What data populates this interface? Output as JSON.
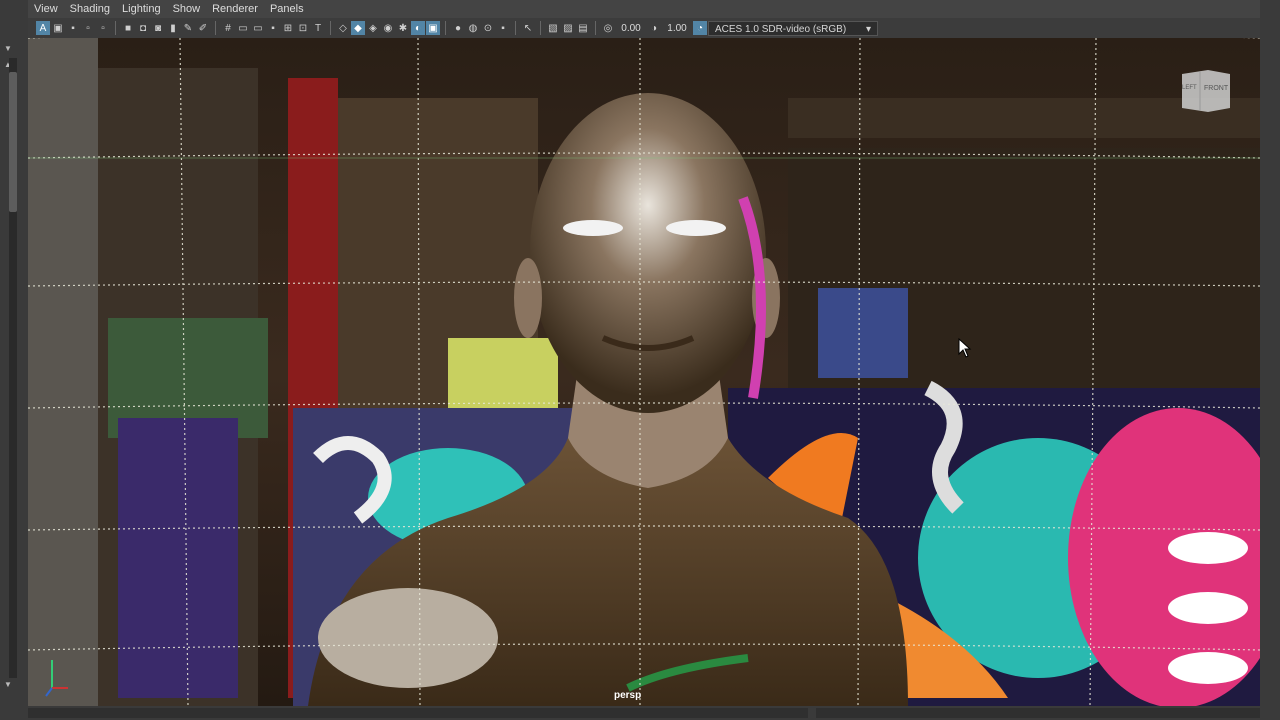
{
  "menu": [
    "View",
    "Shading",
    "Lighting",
    "Show",
    "Renderer",
    "Panels"
  ],
  "toolbar": {
    "exposure_value": "0.00",
    "gamma_value": "1.00",
    "colorspace": "ACES 1.0 SDR-video (sRGB)"
  },
  "viewport": {
    "camera_label": "persp",
    "viewcube_left": "LEFT",
    "viewcube_front": "FRONT"
  },
  "colors": {
    "accent": "#5285a6",
    "grid": "#e8e8d8"
  }
}
